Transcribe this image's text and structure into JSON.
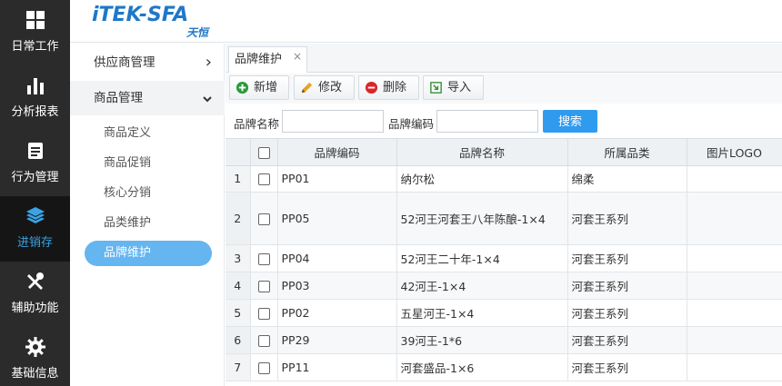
{
  "left_nav": [
    {
      "label": "日常工作",
      "icon": "grid-icon"
    },
    {
      "label": "分析报表",
      "icon": "bar-chart-icon"
    },
    {
      "label": "行为管理",
      "icon": "document-icon"
    },
    {
      "label": "进销存",
      "icon": "layers-icon",
      "active": true
    },
    {
      "label": "辅助功能",
      "icon": "tools-icon"
    },
    {
      "label": "基础信息",
      "icon": "gear-icon"
    }
  ],
  "logo": {
    "brand": "iTEK-SFA",
    "sub": "天恒"
  },
  "submenu": {
    "groups": [
      {
        "label": "供应商管理",
        "caret": "›"
      },
      {
        "label": "商品管理",
        "caret": "⌄"
      }
    ],
    "items": [
      "商品定义",
      "商品促销",
      "核心分销",
      "品类维护",
      "品牌维护"
    ]
  },
  "tab": {
    "label": "品牌维护",
    "close": "×"
  },
  "toolbar": {
    "add": "新增",
    "edit": "修改",
    "delete": "删除",
    "import": "导入"
  },
  "search": {
    "brand_name_label": "品牌名称",
    "brand_name_value": "",
    "brand_code_label": "品牌编码",
    "brand_code_value": "",
    "button": "搜索"
  },
  "table": {
    "headers": {
      "code": "品牌编码",
      "name": "品牌名称",
      "category": "所属品类",
      "logo": "图片LOGO"
    },
    "rows": [
      {
        "n": "1",
        "code": "PP01",
        "name": "纳尔松",
        "category": "绵柔",
        "logo": ""
      },
      {
        "n": "2",
        "code": "PP05",
        "name": "52河王河套王八年陈酿-1×4",
        "category": "河套王系列",
        "logo": ""
      },
      {
        "n": "3",
        "code": "PP04",
        "name": "52河王二十年-1×4",
        "category": "河套王系列",
        "logo": ""
      },
      {
        "n": "4",
        "code": "PP03",
        "name": "42河王-1×4",
        "category": "河套王系列",
        "logo": ""
      },
      {
        "n": "5",
        "code": "PP02",
        "name": "五星河王-1×4",
        "category": "河套王系列",
        "logo": ""
      },
      {
        "n": "6",
        "code": "PP29",
        "name": "39河王-1*6",
        "category": "河套王系列",
        "logo": ""
      },
      {
        "n": "7",
        "code": "PP11",
        "name": "河套盛品-1×6",
        "category": "河套王系列",
        "logo": ""
      }
    ]
  },
  "colors": {
    "nav_bg": "#2b2b2b",
    "accent": "#3aa3e3",
    "search_button": "#2f9bef",
    "active_submenu": "#64b5f0"
  }
}
